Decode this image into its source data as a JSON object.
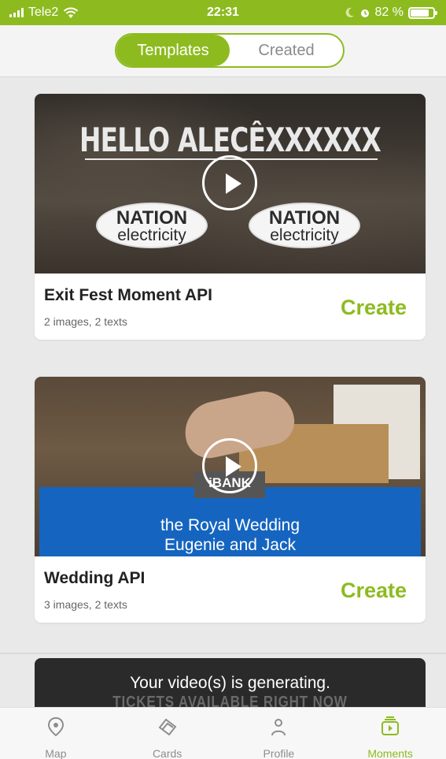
{
  "status_bar": {
    "carrier": "Tele2",
    "time": "22:31",
    "battery": "82 %",
    "battery_level": 0.82
  },
  "segmented": {
    "tabs": [
      {
        "label": "Templates",
        "active": true
      },
      {
        "label": "Created",
        "active": false
      }
    ]
  },
  "cards": [
    {
      "title": "Exit Fest Moment API",
      "meta": "2 images, 2 texts",
      "action": "Create",
      "thumb": {
        "headline": "HELLO ALECÊXXXXXX",
        "logos": [
          {
            "line1": "NATION",
            "line2": "electricity"
          },
          {
            "line1": "NATION",
            "line2": "electricity"
          }
        ]
      }
    },
    {
      "title": "Wedding API",
      "meta": "3 images, 2 texts",
      "action": "Create",
      "thumb": {
        "brand": "iBANK",
        "banner_line1": "the Royal Wedding",
        "banner_line2": "Eugenie and Jack"
      }
    }
  ],
  "toast": {
    "message": "Your video(s) is generating.",
    "background_text": "TICKETS AVAILABLE RIGHT NOW"
  },
  "tabbar": {
    "items": [
      {
        "label": "Map",
        "icon": "map-pin-icon",
        "active": false
      },
      {
        "label": "Cards",
        "icon": "cards-icon",
        "active": false
      },
      {
        "label": "Profile",
        "icon": "profile-icon",
        "active": false
      },
      {
        "label": "Moments",
        "icon": "moments-play-icon",
        "active": true
      }
    ]
  },
  "colors": {
    "accent": "#8dbb1f",
    "banner_blue": "#1565c0"
  }
}
